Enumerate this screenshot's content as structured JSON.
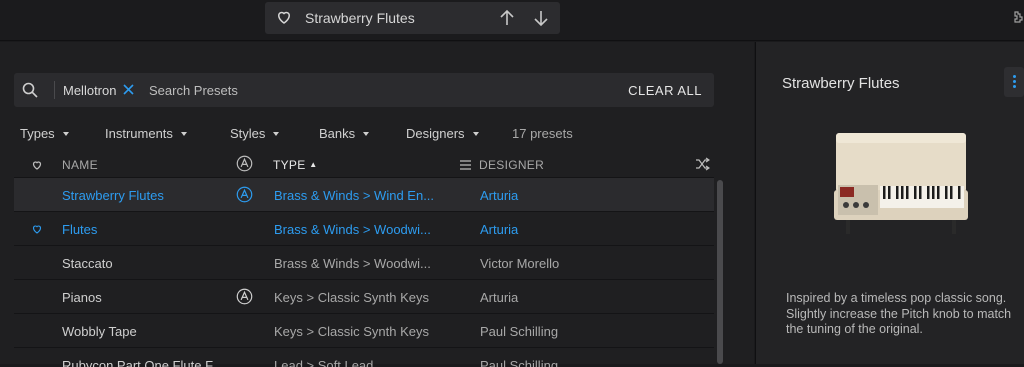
{
  "topbar": {
    "preset_name": "Strawberry Flutes",
    "icons": {
      "favorite": "heart-outline-icon",
      "prev": "arrow-up-icon",
      "next": "arrow-down-icon",
      "corner": "puzzle-icon"
    }
  },
  "browser": {
    "search": {
      "filter_chip": "Mellotron",
      "placeholder": "Search Presets",
      "clear_all": "CLEAR ALL"
    },
    "filters": [
      "Types",
      "Instruments",
      "Styles",
      "Banks",
      "Designers"
    ],
    "preset_count": "17 presets",
    "columns": {
      "name": "NAME",
      "type": "TYPE",
      "designer": "DESIGNER"
    },
    "rows": [
      {
        "name": "Strawberry Flutes",
        "type": "Brass & Winds > Wind En...",
        "designer": "Arturia",
        "selected": true,
        "favorite": false,
        "arturia_badge": true
      },
      {
        "name": "Flutes",
        "type": "Brass & Winds > Woodwi...",
        "designer": "Arturia",
        "selected": false,
        "favorite": true,
        "arturia_badge": false
      },
      {
        "name": "Staccato",
        "type": "Brass & Winds > Woodwi...",
        "designer": "Victor Morello",
        "selected": false,
        "favorite": false,
        "arturia_badge": false
      },
      {
        "name": "Pianos",
        "type": "Keys > Classic Synth Keys",
        "designer": "Arturia",
        "selected": false,
        "favorite": false,
        "arturia_badge": true
      },
      {
        "name": "Wobbly Tape",
        "type": "Keys > Classic Synth Keys",
        "designer": "Paul Schilling",
        "selected": false,
        "favorite": false,
        "arturia_badge": false
      },
      {
        "name": "Rubycon Part One Flute F...",
        "type": "Lead > Soft Lead",
        "designer": "Paul Schilling",
        "selected": false,
        "favorite": false,
        "arturia_badge": false
      }
    ],
    "colors": {
      "accent": "#2d9cf0",
      "selected_row": "#2b2b2e"
    }
  },
  "detail": {
    "title": "Strawberry Flutes",
    "description": "Inspired by a timeless pop classic song. Slightly increase the Pitch knob to match the tuning of the original."
  }
}
